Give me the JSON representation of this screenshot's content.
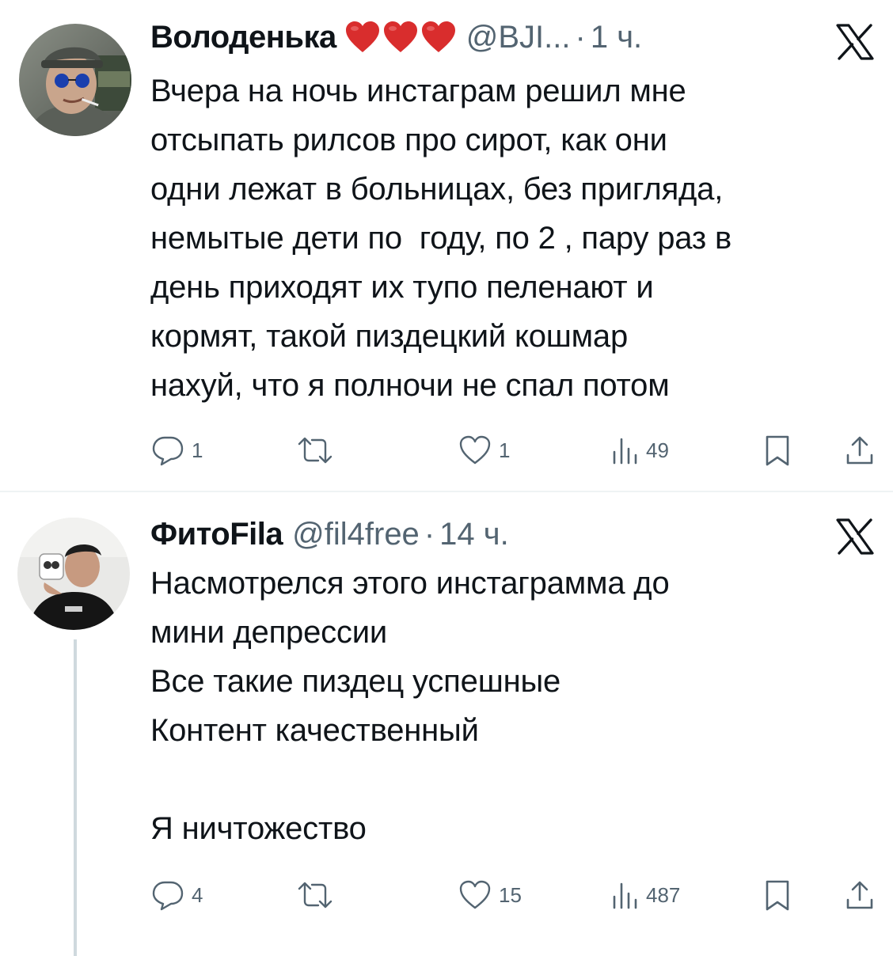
{
  "tweets": [
    {
      "display_name": "Володенька",
      "handle": "@BJI...",
      "separator": "·",
      "time": "1 ч.",
      "text": "Вчера на ночь инстаграм решил мне\nотсыпать рилсов про сирот, как они\nодни лежат в больницах, без пригляда,\nнемытые дети по  году, по 2 , пару раз в\nдень приходят их тупо пеленают и\nкормят, такой пиздецкий кошмар\nнахуй, что я полночи не спал потом",
      "stats": {
        "replies": "1",
        "retweets": "",
        "likes": "1",
        "views": "49"
      },
      "name_emoji": [
        "heart-icon",
        "heart-icon",
        "heart-icon"
      ]
    },
    {
      "display_name": "ФитоFila",
      "handle": "@fil4free",
      "separator": "·",
      "time": "14 ч.",
      "text": "Насмотрелся этого инстаграмма до\nмини депрессии\nВсе такие пиздец успешные\nКонтент качественный\n\nЯ ничтожество",
      "stats": {
        "replies": "4",
        "retweets": "",
        "likes": "15",
        "views": "487"
      }
    }
  ],
  "colors": {
    "text_primary": "#0f1419",
    "text_secondary": "#536471",
    "heart_red": "#d92d2d",
    "separator": "#eff3f4",
    "thread_line": "#cfd9de"
  },
  "icons": {
    "reply": "speech-bubble-icon",
    "retweet": "retweet-arrows-icon",
    "like": "heart-outline-icon",
    "views": "bar-chart-icon",
    "bookmark": "bookmark-icon",
    "share": "share-upload-icon",
    "platform": "x-logo-icon"
  }
}
